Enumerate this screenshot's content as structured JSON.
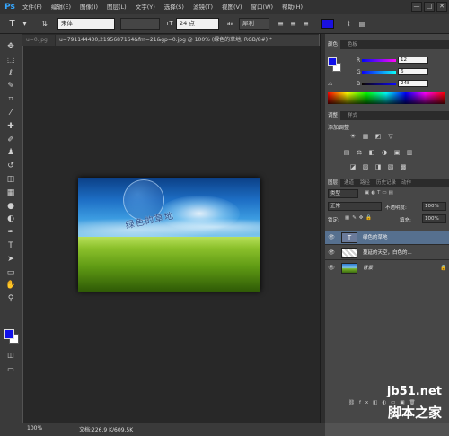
{
  "menubar": {
    "logo": "Ps",
    "items": [
      "文件(F)",
      "编辑(E)",
      "图像(I)",
      "图层(L)",
      "文字(Y)",
      "选择(S)",
      "滤镜(T)",
      "视图(V)",
      "窗口(W)",
      "帮助(H)"
    ],
    "window_controls": [
      "—",
      "□",
      "✕"
    ]
  },
  "options": {
    "tool_icon": "T",
    "font_family": "宋体",
    "font_size": "24 点",
    "antialias": "犀利",
    "text_color": "#1a10e0"
  },
  "tabs": [
    {
      "label": "u=0.jpg"
    },
    {
      "label": "u=791144430,2195687164&fm=21&gp=0.jpg @ 100% (绿色的草地, RGB/8#) *"
    }
  ],
  "toolbar": {
    "tools": [
      {
        "name": "move-tool",
        "glyph": "✥"
      },
      {
        "name": "marquee-tool",
        "glyph": "⬚"
      },
      {
        "name": "lasso-tool",
        "glyph": "ℓ"
      },
      {
        "name": "quick-select-tool",
        "glyph": "✎"
      },
      {
        "name": "crop-tool",
        "glyph": "⌗"
      },
      {
        "name": "eyedropper-tool",
        "glyph": "⁄"
      },
      {
        "name": "healing-tool",
        "glyph": "✚"
      },
      {
        "name": "brush-tool",
        "glyph": "✐"
      },
      {
        "name": "clone-stamp-tool",
        "glyph": "♟"
      },
      {
        "name": "history-brush-tool",
        "glyph": "↺"
      },
      {
        "name": "eraser-tool",
        "glyph": "◫"
      },
      {
        "name": "gradient-tool",
        "glyph": "▦"
      },
      {
        "name": "blur-tool",
        "glyph": "●"
      },
      {
        "name": "dodge-tool",
        "glyph": "◐"
      },
      {
        "name": "pen-tool",
        "glyph": "✒"
      },
      {
        "name": "type-tool",
        "glyph": "T"
      },
      {
        "name": "path-select-tool",
        "glyph": "➤"
      },
      {
        "name": "shape-tool",
        "glyph": "▭"
      },
      {
        "name": "hand-tool",
        "glyph": "✋"
      },
      {
        "name": "zoom-tool",
        "glyph": "⚲"
      }
    ],
    "foreground_color": "#1010e8",
    "background_color": "#ffffff"
  },
  "image": {
    "text": "绿色的草地"
  },
  "color_panel": {
    "tabs": [
      "颜色",
      "色板"
    ],
    "r_label": "R",
    "g_label": "G",
    "b_label": "B",
    "r": "12",
    "g": "6",
    "b": "248"
  },
  "adjust_panel": {
    "tabs": [
      "调整",
      "样式"
    ],
    "title": "添加调整",
    "icons": [
      "☀",
      "▦",
      "◩",
      "▽",
      "▤",
      "⚖",
      "◧",
      "◑",
      "▣",
      "▥",
      "◪",
      "▨",
      "◨",
      "▧",
      "▩"
    ]
  },
  "layers_panel": {
    "tabs": [
      "图层",
      "通道",
      "路径",
      "历史记录",
      "动作"
    ],
    "kind_filter": "类型",
    "blend_mode": "正常",
    "opacity_label": "不透明度:",
    "opacity": "100%",
    "lock_label": "锁定:",
    "fill_label": "填充:",
    "fill": "100%",
    "layers": [
      {
        "name": "绿色的草地",
        "selected": true,
        "extra": ""
      },
      {
        "name": "蔓延的天空，白色的...",
        "selected": false,
        "extra": ""
      },
      {
        "name": "背景",
        "selected": false,
        "extra": "🔒"
      }
    ]
  },
  "status": {
    "zoom": "100%",
    "doc_size": "文档:226.9 K/609.5K"
  },
  "watermark": {
    "host": "jb51.net",
    "site": "脚本之家"
  }
}
